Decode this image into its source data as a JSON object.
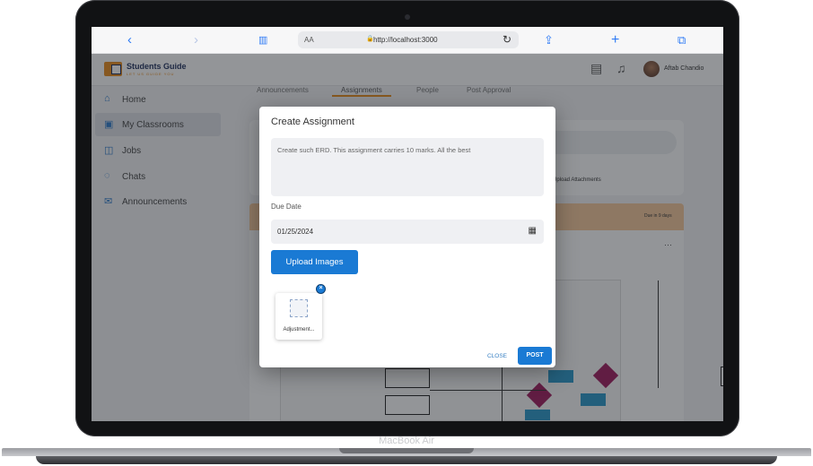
{
  "browser": {
    "back_icon": "‹",
    "forward_icon": "›",
    "reader_icon": "📖",
    "aa_label": "AA",
    "url": "http://localhost:3000",
    "reload_icon": "↻",
    "share_icon": "⇪",
    "new_tab_icon": "+",
    "tabs_icon": "⧉"
  },
  "app": {
    "brand": "Students Guide",
    "brand_tagline": "LET US GUIDE YOU",
    "user_name": "Aftab Chandio",
    "notification_icon": "🔔",
    "message_icon": "💬"
  },
  "sidebar": {
    "items": [
      {
        "label": "Home",
        "icon": "home-icon",
        "glyph": "⌂"
      },
      {
        "label": "My Classrooms",
        "icon": "classroom-icon",
        "glyph": "▣"
      },
      {
        "label": "Jobs",
        "icon": "jobs-icon",
        "glyph": "◫"
      },
      {
        "label": "Chats",
        "icon": "chat-icon",
        "glyph": "◌"
      },
      {
        "label": "Announcements",
        "icon": "megaphone-icon",
        "glyph": "✉"
      }
    ],
    "active_index": 1
  },
  "background": {
    "tabs": [
      "Announcements",
      "Assignments",
      "People",
      "Post Approval"
    ],
    "upload_attachments": "Upload Attachments",
    "due_in": "Due in 9 days",
    "more": "···"
  },
  "modal": {
    "title": "Create Assignment",
    "description": "Create such ERD. This assignment carries 10 marks. All the best",
    "due_date_label": "Due Date",
    "due_date_value": "01/25/2024",
    "calendar_icon": "▦",
    "upload_button": "Upload Images",
    "attachment_name": "Adjustment...",
    "remove_icon": "×",
    "close_button": "CLOSE",
    "post_button": "POST"
  },
  "device": {
    "label": "MacBook Air"
  },
  "colors": {
    "primary": "#1a7ad4",
    "brand_orange": "#e88a1a",
    "banner": "#f6c89a"
  }
}
